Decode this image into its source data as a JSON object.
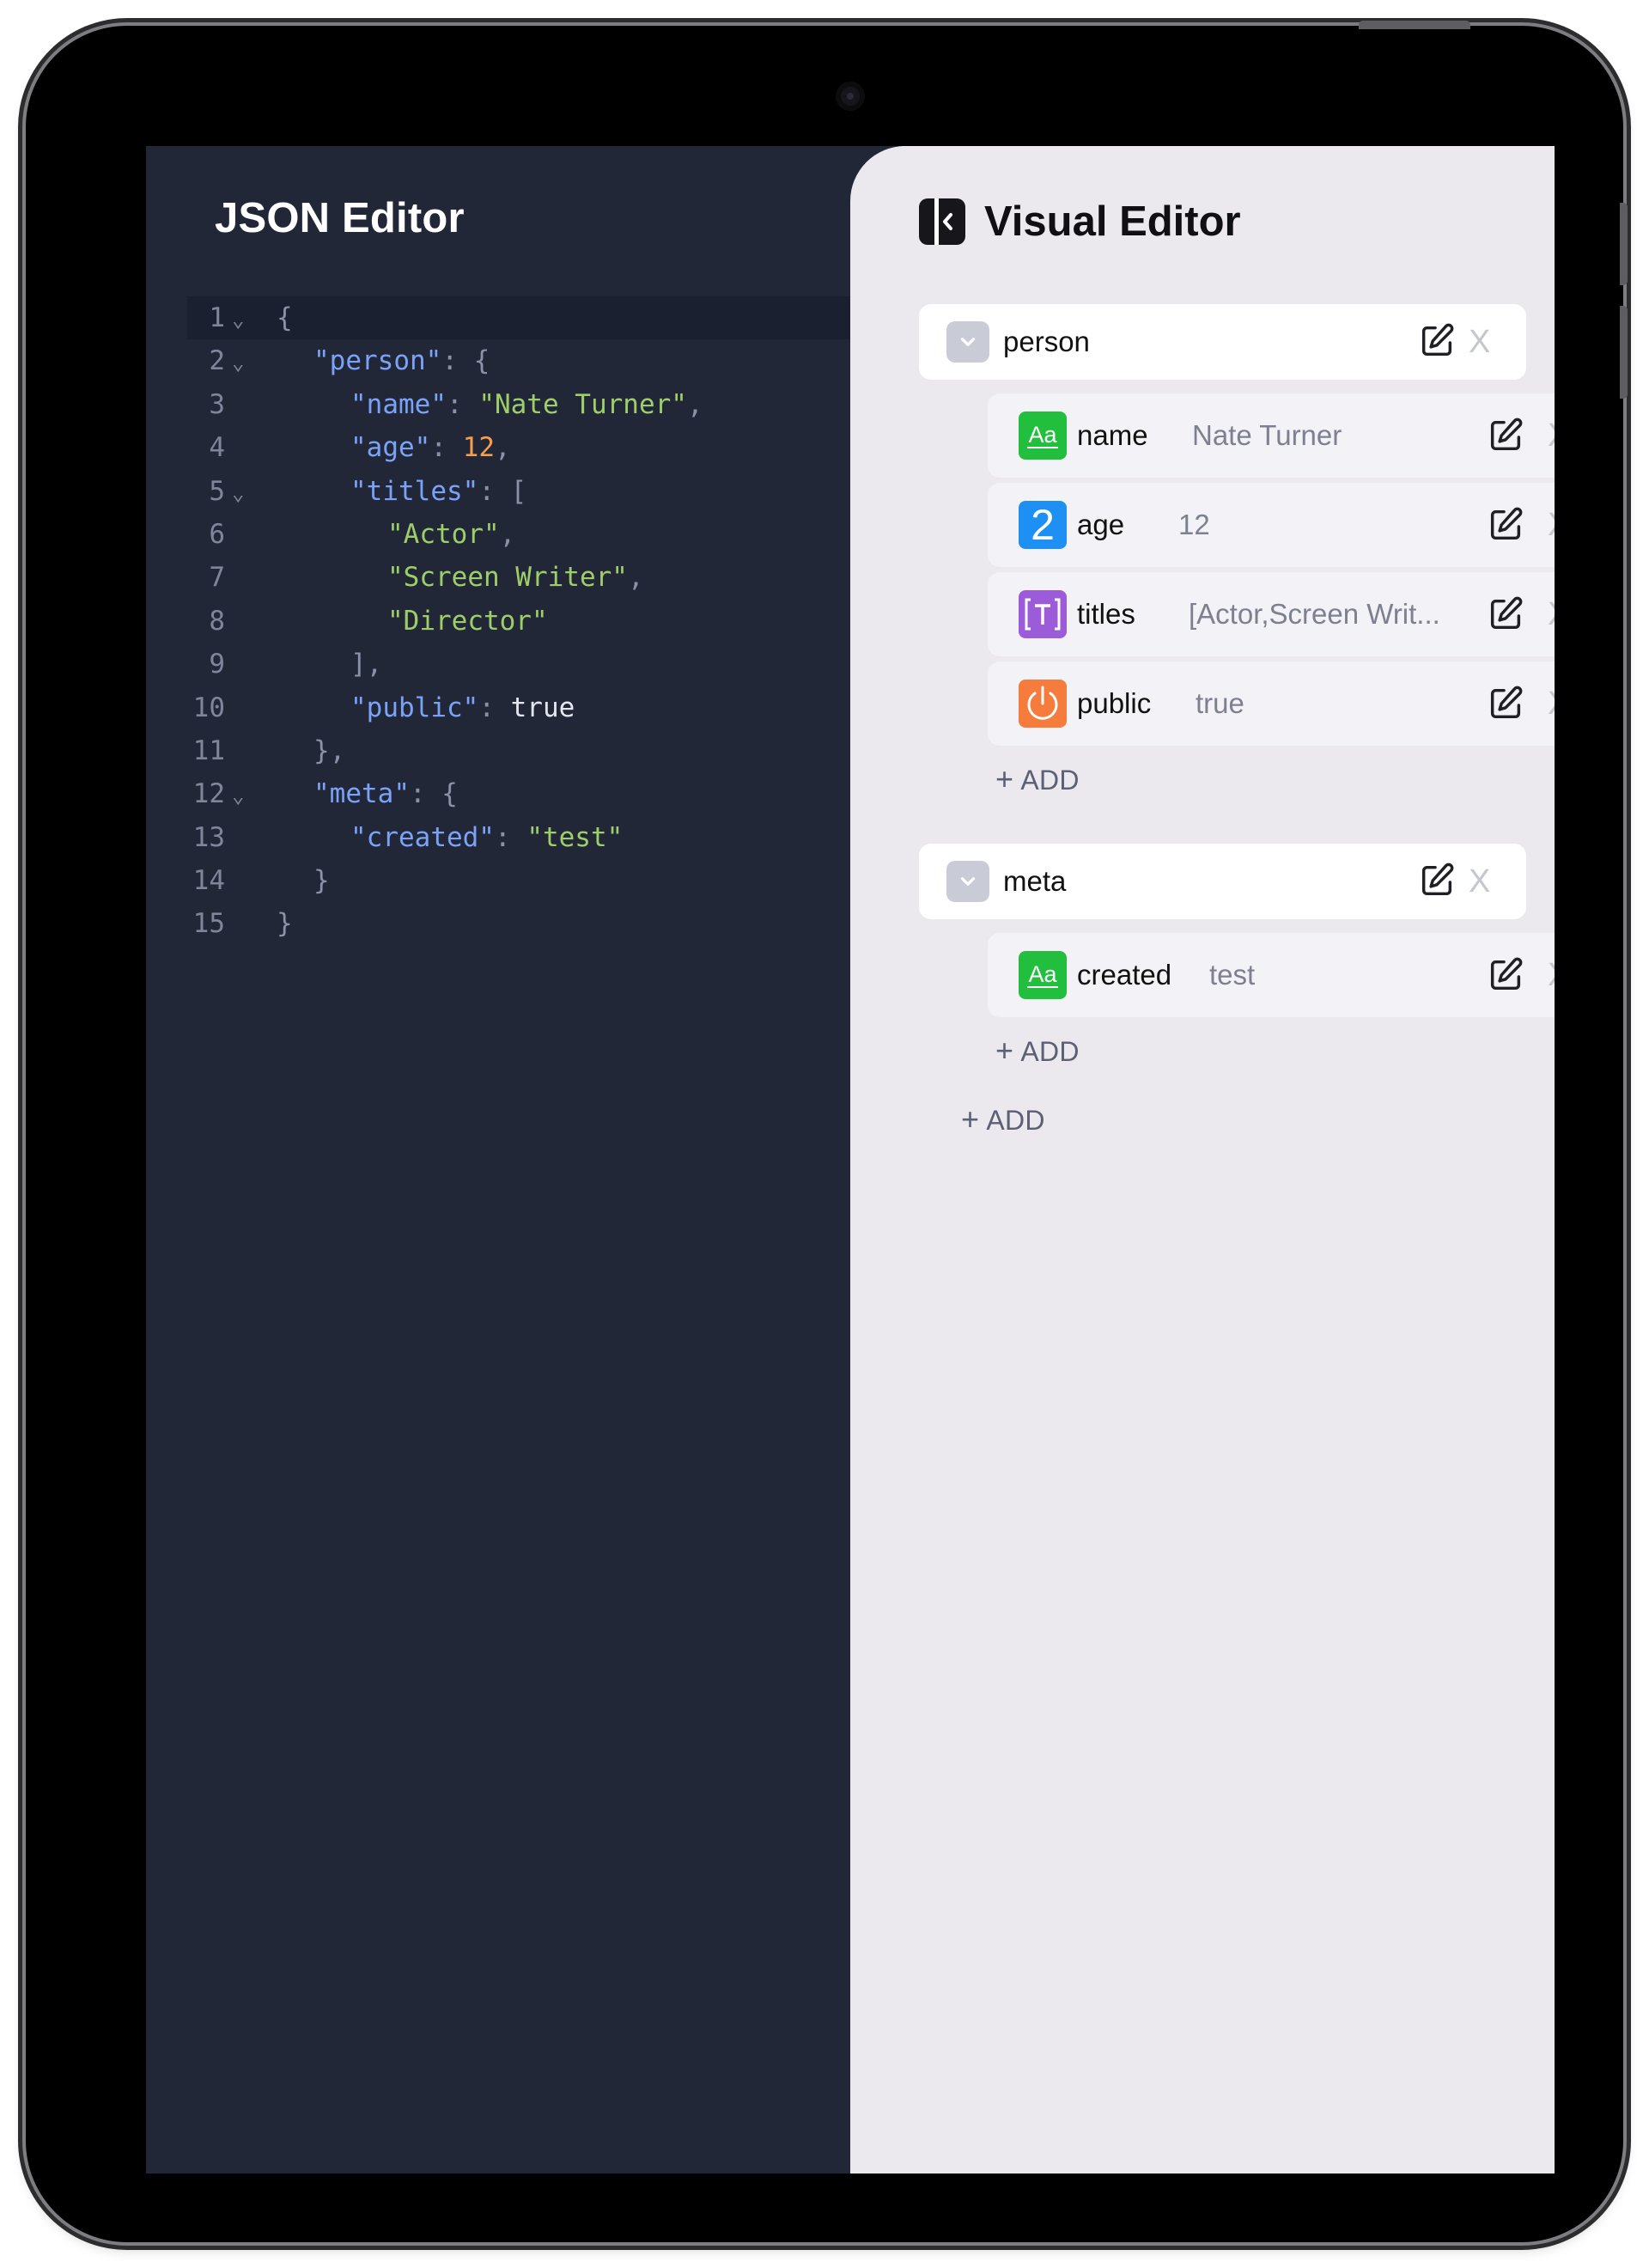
{
  "json_editor": {
    "title": "JSON Editor",
    "lines": [
      {
        "num": "1",
        "fold": true,
        "indent": 0,
        "tokens": [
          {
            "t": "{",
            "c": "punc"
          }
        ]
      },
      {
        "num": "2",
        "fold": true,
        "indent": 1,
        "tokens": [
          {
            "t": "\"person\"",
            "c": "key"
          },
          {
            "t": ": {",
            "c": "punc"
          }
        ]
      },
      {
        "num": "3",
        "fold": false,
        "indent": 2,
        "tokens": [
          {
            "t": "\"name\"",
            "c": "key"
          },
          {
            "t": ": ",
            "c": "punc"
          },
          {
            "t": "\"Nate Turner\"",
            "c": "str"
          },
          {
            "t": ",",
            "c": "punc"
          }
        ]
      },
      {
        "num": "4",
        "fold": false,
        "indent": 2,
        "tokens": [
          {
            "t": "\"age\"",
            "c": "key"
          },
          {
            "t": ": ",
            "c": "punc"
          },
          {
            "t": "12",
            "c": "num"
          },
          {
            "t": ",",
            "c": "punc"
          }
        ]
      },
      {
        "num": "5",
        "fold": true,
        "indent": 2,
        "tokens": [
          {
            "t": "\"titles\"",
            "c": "key"
          },
          {
            "t": ": [",
            "c": "punc"
          }
        ]
      },
      {
        "num": "6",
        "fold": false,
        "indent": 3,
        "tokens": [
          {
            "t": "\"Actor\"",
            "c": "str"
          },
          {
            "t": ",",
            "c": "punc"
          }
        ]
      },
      {
        "num": "7",
        "fold": false,
        "indent": 3,
        "tokens": [
          {
            "t": "\"Screen Writer\"",
            "c": "str"
          },
          {
            "t": ",",
            "c": "punc"
          }
        ]
      },
      {
        "num": "8",
        "fold": false,
        "indent": 3,
        "tokens": [
          {
            "t": "\"Director\"",
            "c": "str"
          }
        ]
      },
      {
        "num": "9",
        "fold": false,
        "indent": 2,
        "tokens": [
          {
            "t": "],",
            "c": "punc"
          }
        ]
      },
      {
        "num": "10",
        "fold": false,
        "indent": 2,
        "tokens": [
          {
            "t": "\"public\"",
            "c": "key"
          },
          {
            "t": ": ",
            "c": "punc"
          },
          {
            "t": "true",
            "c": "bool"
          }
        ]
      },
      {
        "num": "11",
        "fold": false,
        "indent": 1,
        "tokens": [
          {
            "t": "},",
            "c": "punc"
          }
        ]
      },
      {
        "num": "12",
        "fold": true,
        "indent": 1,
        "tokens": [
          {
            "t": "\"meta\"",
            "c": "key"
          },
          {
            "t": ": {",
            "c": "punc"
          }
        ]
      },
      {
        "num": "13",
        "fold": false,
        "indent": 2,
        "tokens": [
          {
            "t": "\"created\"",
            "c": "key"
          },
          {
            "t": ": ",
            "c": "punc"
          },
          {
            "t": "\"test\"",
            "c": "str"
          }
        ]
      },
      {
        "num": "14",
        "fold": false,
        "indent": 1,
        "tokens": [
          {
            "t": "}",
            "c": "punc"
          }
        ]
      },
      {
        "num": "15",
        "fold": false,
        "indent": 0,
        "tokens": [
          {
            "t": "}",
            "c": "punc"
          }
        ]
      }
    ]
  },
  "visual_editor": {
    "title": "Visual Editor",
    "objects": [
      {
        "name": "person",
        "fields": [
          {
            "key": "name",
            "value": "Nate Turner",
            "type": "text",
            "icon": "text-type-icon"
          },
          {
            "key": "age",
            "value": "12",
            "type": "number",
            "icon": "number-type-icon"
          },
          {
            "key": "titles",
            "value": "[Actor,Screen Writ...",
            "type": "array",
            "icon": "array-type-icon"
          },
          {
            "key": "public",
            "value": "true",
            "type": "boolean",
            "icon": "boolean-type-icon"
          }
        ],
        "add_label": "ADD"
      },
      {
        "name": "meta",
        "fields": [
          {
            "key": "created",
            "value": "test",
            "type": "text",
            "icon": "text-type-icon"
          }
        ],
        "add_label": "ADD"
      }
    ],
    "root_add_label": "ADD",
    "icons": {
      "text": "Aa",
      "number": "2",
      "edit": "edit-icon",
      "delete": "X",
      "collapse": "chevron-down-icon"
    }
  },
  "colors": {
    "json_bg": "#222738",
    "visual_bg": "#ebe9ee",
    "key": "#7aa2f7",
    "string": "#9ece6a",
    "number": "#f59e4e",
    "text_type": "#22bf3e",
    "number_type": "#1e90f3",
    "array_type": "#9c5cd9",
    "boolean_type": "#f57c3d"
  }
}
